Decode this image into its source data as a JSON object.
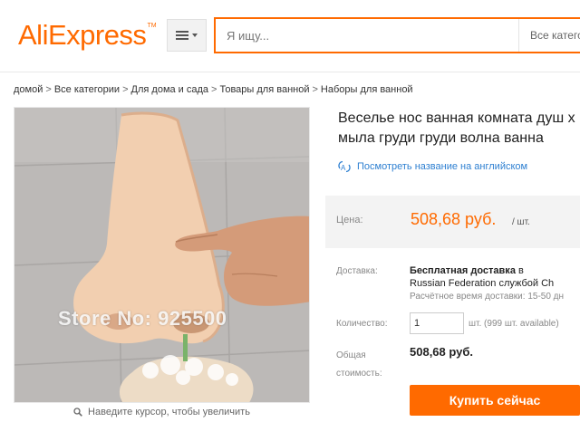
{
  "header": {
    "logo_main": "AliExpress",
    "logo_tm": "TM",
    "search_placeholder": "Я ищу...",
    "search_category": "Все категории"
  },
  "breadcrumb": [
    "домой",
    "Все категории",
    "Для дома и сада",
    "Товары для ванной",
    "Наборы для ванной"
  ],
  "breadcrumb_sep": ">",
  "gallery": {
    "watermark": "Store No: 925500",
    "zoom_hint": "Наведите курсор, чтобы увеличить"
  },
  "product": {
    "title_line1": "Веселье нос ванная комната душ х",
    "title_line2": "мыла груди груди волна ванна",
    "translate_link": "Посмотреть название на английском",
    "price_label": "Цена:",
    "price_value": "508,68 руб.",
    "price_unit": "/ шт.",
    "shipping_label": "Доставка:",
    "shipping_free": "Бесплатная доставка",
    "shipping_in": "в",
    "shipping_dest": "Russian Federation службой Ch",
    "shipping_eta": "Расчётное время доставки: 15-50 дн",
    "qty_label": "Количество:",
    "qty_value": "1",
    "qty_unit": "шт. (999 шт. available)",
    "total_label_1": "Общая",
    "total_label_2": "стоимость:",
    "total_value": "508,68 руб.",
    "buy_button": "Купить сейчас"
  },
  "colors": {
    "brand": "#ff6a00",
    "link": "#2d7fd1"
  }
}
